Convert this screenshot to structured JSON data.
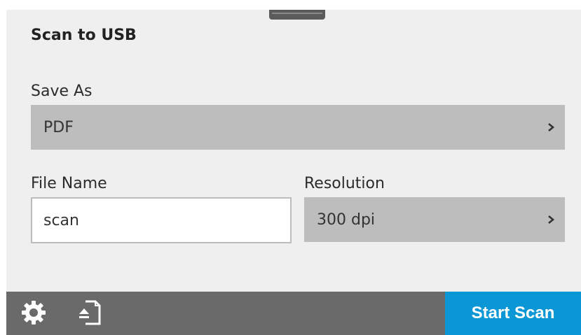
{
  "header": {
    "title": "Scan to USB"
  },
  "save_as": {
    "label": "Save As",
    "value": "PDF",
    "chevron_icon": "chevron-right-icon"
  },
  "file_name": {
    "label": "File Name",
    "value": "scan"
  },
  "resolution": {
    "label": "Resolution",
    "value": "300 dpi",
    "chevron_icon": "chevron-right-icon"
  },
  "footer": {
    "settings_icon": "gear-icon",
    "preview_icon": "document-eject-icon",
    "start_label": "Start Scan"
  },
  "colors": {
    "accent": "#0b96d6",
    "panel": "#efefef",
    "row": "#bdbdbd",
    "footer": "#6a6a6a"
  }
}
